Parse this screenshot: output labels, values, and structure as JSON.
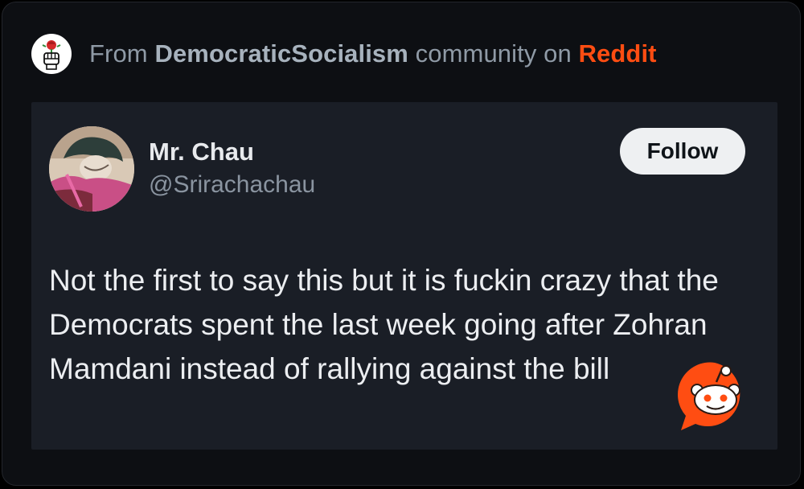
{
  "header": {
    "prefix": "From",
    "community": "DemocraticSocialism",
    "middle": "community on",
    "platform": "Reddit",
    "logo_icon": "rose-fist-icon"
  },
  "post": {
    "author_name": "Mr. Chau",
    "author_handle": "@Srirachachau",
    "follow_label": "Follow",
    "text": "Not the first to say this but it is fuckin crazy that the Democrats spent the last week going after Zohran Mamdani instead of rallying against the bill",
    "avatar_icon": "cartoon-avatar-icon",
    "badge_icon": "reddit-snoo-icon"
  },
  "colors": {
    "background": "#0d0f13",
    "card": "#1a1e26",
    "reddit_orange": "#ff4d12",
    "follow_button": "#eef0f2"
  }
}
